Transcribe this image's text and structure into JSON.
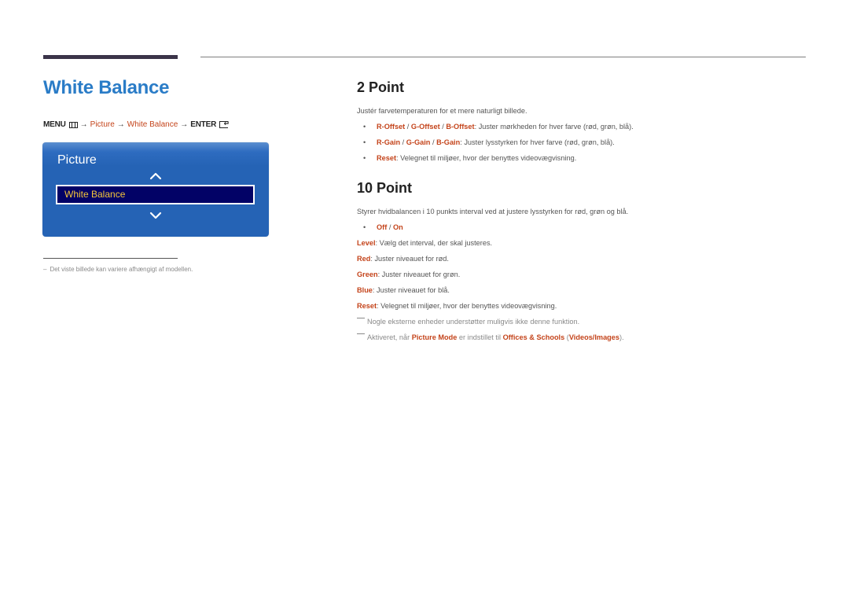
{
  "page": {
    "title": "White Balance"
  },
  "breadcrumb": {
    "menu": "MENU",
    "menu_icon": "menu-grid-icon",
    "arrow": "→",
    "items": [
      "Picture",
      "White Balance"
    ],
    "enter": "ENTER",
    "enter_icon": "enter-icon"
  },
  "osd": {
    "title": "Picture",
    "up_icon": "chevron-up-icon",
    "selected_item": "White Balance",
    "down_icon": "chevron-down-icon"
  },
  "footnote": {
    "dash": "–",
    "text": "Det viste billede kan variere afhængigt af modellen."
  },
  "section_2point": {
    "heading": "2 Point",
    "intro": "Justér farvetemperaturen for et mere naturligt billede.",
    "bullets": [
      {
        "terms": [
          "R-Offset",
          "G-Offset",
          "B-Offset"
        ],
        "separator": " / ",
        "text": ": Juster mørkheden for hver farve (rød, grøn, blå)."
      },
      {
        "terms": [
          "R-Gain",
          "G-Gain",
          "B-Gain"
        ],
        "separator": " / ",
        "text": ": Juster lysstyrken for hver farve (rød, grøn, blå)."
      },
      {
        "terms": [
          "Reset"
        ],
        "text": ": Velegnet til miljøer, hvor der benyttes videovægvisning."
      }
    ]
  },
  "section_10point": {
    "heading": "10 Point",
    "intro": "Styrer hvidbalancen i 10 punkts interval ved at justere lysstyrken for rød, grøn og blå.",
    "options": {
      "off": "Off",
      "separator": " / ",
      "on": "On"
    },
    "items": [
      {
        "term": "Level",
        "text": ": Vælg det interval, der skal justeres."
      },
      {
        "term": "Red",
        "text": ": Juster niveauet for rød."
      },
      {
        "term": "Green",
        "text": ": Juster niveauet for grøn."
      },
      {
        "term": "Blue",
        "text": ": Juster niveauet for blå."
      },
      {
        "term": "Reset",
        "text": ": Velegnet til miljøer, hvor der benyttes videovægvisning."
      }
    ],
    "notes": [
      {
        "text": "Nogle eksterne enheder understøtter muligvis ikke denne funktion."
      },
      {
        "prefix": "Aktiveret, når ",
        "term1": "Picture Mode",
        "middle": " er indstillet til ",
        "term2": "Offices & Schools",
        "open": " (",
        "term3": "Videos/Images",
        "close": ")."
      }
    ]
  },
  "colors": {
    "title_blue": "#2a7cc7",
    "highlight_orange": "#c4441b",
    "osd_blue": "#2563b5",
    "osd_selected_bg": "#020266",
    "osd_selected_text": "#f4c53a",
    "top_bar": "#3b3449"
  }
}
